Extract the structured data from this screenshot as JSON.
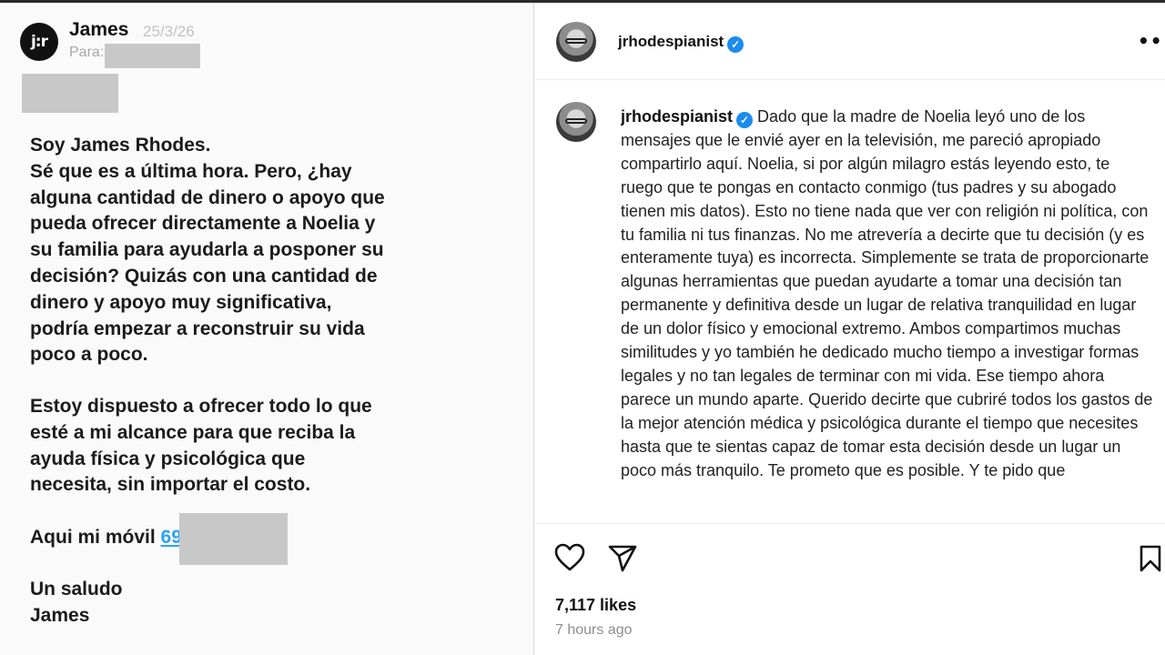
{
  "message": {
    "logo_text": "j:r",
    "sender": "James",
    "date": "25/3/26",
    "to_label": "Para:",
    "paragraph1": "Soy James Rhodes.\nSé que es a última hora. Pero, ¿hay alguna cantidad de dinero o apoyo que pueda ofrecer directamente a Noelia y su familia para ayudarla a posponer su decisión? Quizás con una cantidad de dinero y apoyo muy significativa, podría empezar a reconstruir su vida poco a poco.",
    "paragraph2": "Estoy dispuesto a ofrecer todo lo que esté a mi alcance para que reciba la ayuda física y psicológica que necesita, sin importar el costo.",
    "phone_label": "Aqui mi móvil ",
    "phone_visible": "69",
    "signoff": "Un saludo\nJames"
  },
  "post": {
    "username": "jrhodespianist",
    "verified_glyph": "✓",
    "more_glyph": "•••",
    "caption": "Dado que la madre de Noelia leyó uno de los mensajes que le envié ayer en la televisión, me pareció apropiado compartirlo aquí. Noelia, si por algún milagro estás leyendo esto, te ruego que te pongas en contacto conmigo (tus padres y su abogado tienen mis datos). Esto no tiene nada que ver con religión ni política, con tu familia ni tus finanzas. No me atrevería a decirte que tu decisión (y es enteramente tuya) es incorrecta. Simplemente se trata de proporcionarte algunas herramientas que puedan ayudarte a tomar una decisión tan permanente y definitiva desde un lugar de relativa tranquilidad en lugar de un dolor físico y emocional extremo. Ambos compartimos muchas similitudes y yo también he dedicado mucho tiempo a investigar formas legales y no tan legales de terminar con mi vida. Ese tiempo ahora parece un mundo aparte. Querido decirte que cubriré todos los gastos de la mejor atención médica y psicológica durante el tiempo que necesites hasta que te sientas capaz de tomar esta decisión desde un lugar un poco más tranquilo. Te prometo que es posible. Y te pido que",
    "likes": "7,117 likes",
    "time": "7 hours ago",
    "icons": [
      "heart-icon",
      "share-icon",
      "bookmark-icon",
      "more-icon",
      "verified-icon"
    ]
  }
}
